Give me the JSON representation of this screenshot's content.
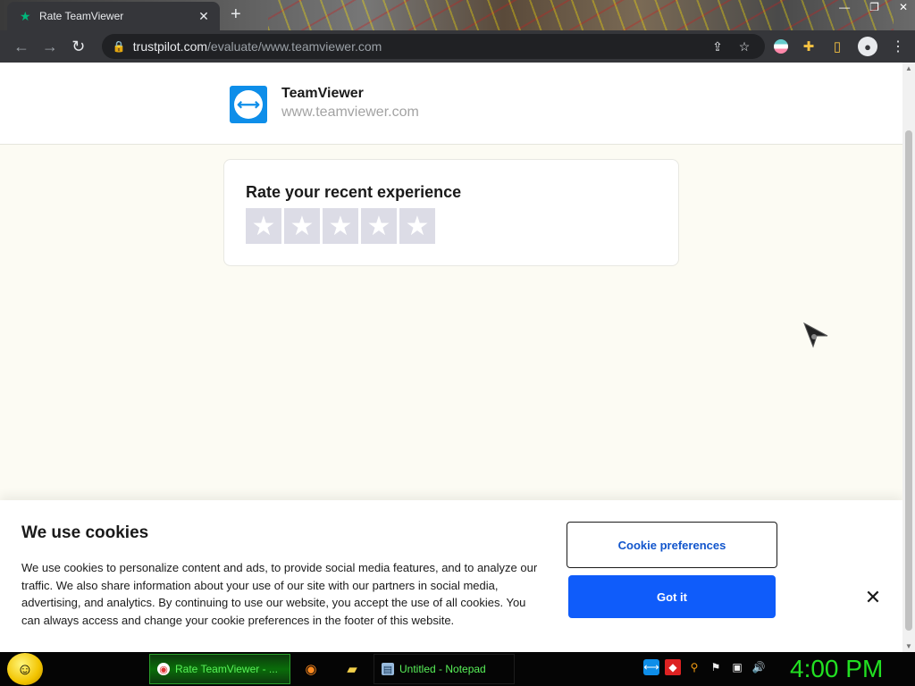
{
  "browser": {
    "tab_title": "Rate TeamViewer",
    "new_tab": "+",
    "url_host": "trustpilot.com",
    "url_path": "/evaluate/www.teamviewer.com"
  },
  "company": {
    "name": "TeamViewer",
    "website": "www.teamviewer.com"
  },
  "rating": {
    "title": "Rate your recent experience",
    "stars": [
      "★",
      "★",
      "★",
      "★",
      "★"
    ]
  },
  "cookie": {
    "title": "We use cookies",
    "text": "We use cookies to personalize content and ads, to provide social media features, and to analyze our traffic. We also share information about your use of our site with our partners in social media, advertising, and analytics. By continuing to use our website, you accept the use of all cookies. You can always access and change your cookie preferences in the footer of this website.",
    "preferences_label": "Cookie preferences",
    "accept_label": "Got it",
    "close_label": "✕"
  },
  "taskbar": {
    "items": [
      {
        "label": "Rate TeamViewer - ..."
      },
      {
        "label": "Untitled - Notepad"
      }
    ],
    "clock": "4:00 PM"
  },
  "colors": {
    "accent_blue": "#0f5cfa",
    "trustpilot_green": "#00b67a",
    "clock_green": "#22e022",
    "teamviewer_blue": "#0e8ee9"
  }
}
